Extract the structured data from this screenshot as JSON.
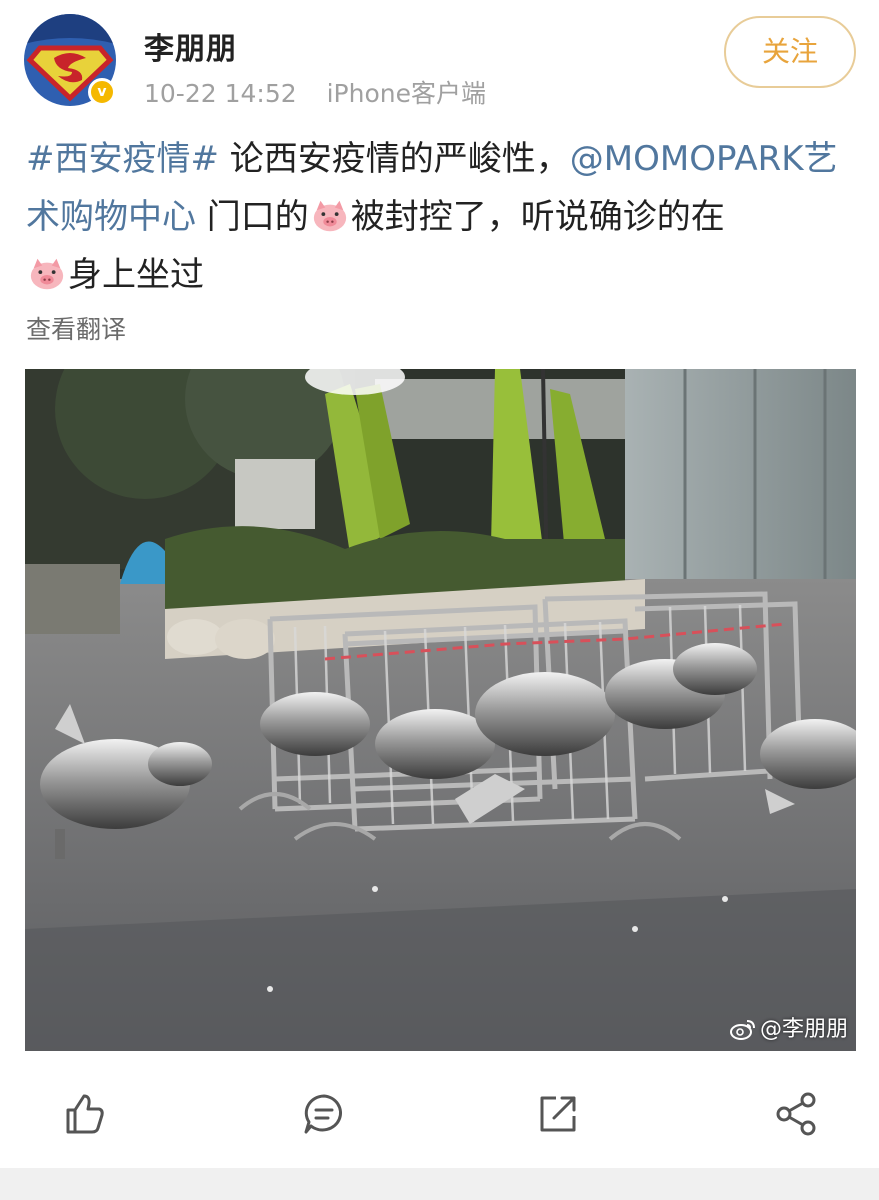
{
  "post": {
    "username": "李朋朋",
    "time": "10-22 14:52",
    "source": "iPhone客户端",
    "follow_label": "关注",
    "text_tag": "#西安疫情#",
    "text_part1": " 论西安疫情的严峻性，",
    "text_mention": "@MOMOPARK艺术购物中心",
    "text_part2": " 门口的",
    "text_part3": "被封控了，听说确诊的在",
    "text_part4": "身上坐过",
    "translate_label": "查看翻译",
    "watermark": "@李朋朋"
  },
  "icons": {
    "avatar": "superman-avatar",
    "verified": "verified-badge-icon",
    "emoji": "pig-emoji-icon",
    "like": "thumbs-up-icon",
    "comment": "comment-icon",
    "share": "share-icon",
    "forward": "forward-icon",
    "watermark_logo": "weibo-logo-icon"
  },
  "colors": {
    "link": "#51779e",
    "follow": "#e8a43c",
    "meta": "#a0a0a0"
  }
}
